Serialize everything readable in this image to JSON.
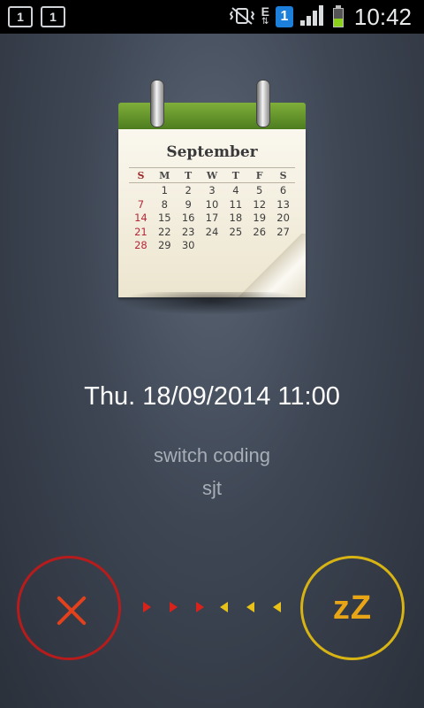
{
  "status_bar": {
    "notification_1": "1",
    "notification_2": "1",
    "network_type": "E",
    "sim_label": "1",
    "time": "10:42"
  },
  "calendar_icon": {
    "month": "September",
    "weekdays": [
      "S",
      "M",
      "T",
      "W",
      "T",
      "F",
      "S"
    ],
    "weeks": [
      [
        "",
        "1",
        "2",
        "3",
        "4",
        "5",
        "6"
      ],
      [
        "7",
        "8",
        "9",
        "10",
        "11",
        "12",
        "13"
      ],
      [
        "14",
        "15",
        "16",
        "17",
        "18",
        "19",
        "20"
      ],
      [
        "21",
        "22",
        "23",
        "24",
        "25",
        "26",
        "27"
      ],
      [
        "28",
        "29",
        "30",
        "",
        "",
        "",
        ""
      ]
    ],
    "header_color": "#5f8f2a",
    "sunday_color": "#b4283a"
  },
  "alarm": {
    "datetime": "Thu. 18/09/2014 11:00",
    "title": "switch coding",
    "location": "sjt"
  },
  "actions": {
    "dismiss_icon": "close-icon",
    "dismiss_color": "#b71c1c",
    "snooze_label": "zZ",
    "snooze_color": "#d8b314"
  }
}
